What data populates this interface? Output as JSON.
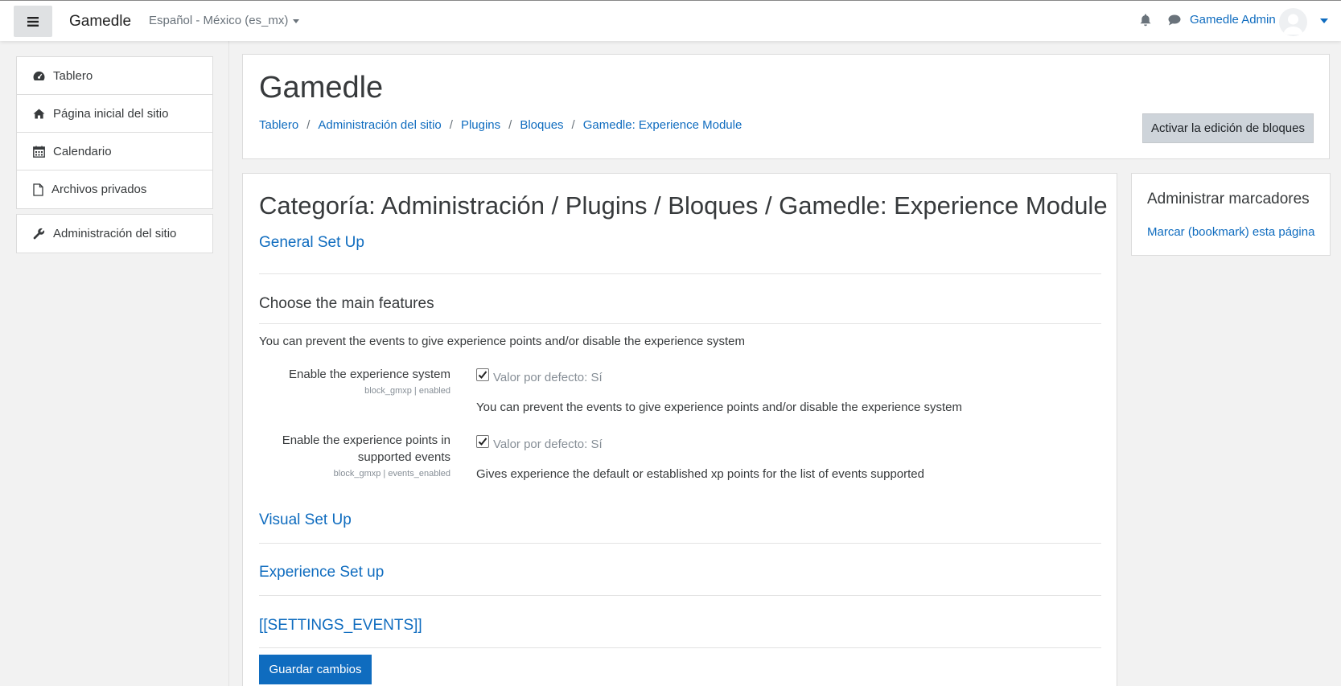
{
  "navbar": {
    "brand": "Gamedle",
    "language": "Español - México (es_mx)",
    "user_name": "Gamedle Admin"
  },
  "sidebar": {
    "items": [
      {
        "label": "Tablero",
        "icon": "dashboard-icon"
      },
      {
        "label": "Página inicial del sitio",
        "icon": "home-icon"
      },
      {
        "label": "Calendario",
        "icon": "calendar-icon"
      },
      {
        "label": "Archivos privados",
        "icon": "file-icon"
      }
    ],
    "admin": {
      "label": "Administración del sitio",
      "icon": "wrench-icon"
    }
  },
  "header": {
    "title": "Gamedle",
    "breadcrumb": [
      "Tablero",
      "Administración del sitio",
      "Plugins",
      "Bloques",
      "Gamedle: Experience Module"
    ],
    "edit_button": "Activar la edición de bloques"
  },
  "main": {
    "category_title": "Categoría: Administración / Plugins / Bloques / Gamedle: Experience Module",
    "general_setup": "General Set Up",
    "features_heading": "Choose the main features",
    "features_desc": "You can prevent the events to give experience points and/or disable the experience system",
    "settings": [
      {
        "label": "Enable the experience system",
        "key": "block_gmxp | enabled",
        "checked": true,
        "default": "Valor por defecto: Sí",
        "description": "You can prevent the events to give experience points and/or disable the experience system"
      },
      {
        "label_line1": "Enable the experience points in",
        "label_line2": "supported events",
        "key": "block_gmxp | events_enabled",
        "checked": true,
        "default": "Valor por defecto: Sí",
        "description": "Gives experience the default or established xp points for the list of events supported"
      }
    ],
    "visual_setup": "Visual Set Up",
    "experience_setup": "Experience Set up",
    "settings_events": "[[SETTINGS_EVENTS]]",
    "save_button": "Guardar cambios"
  },
  "block": {
    "title": "Administrar marcadores",
    "link": "Marcar (bookmark) esta página"
  }
}
